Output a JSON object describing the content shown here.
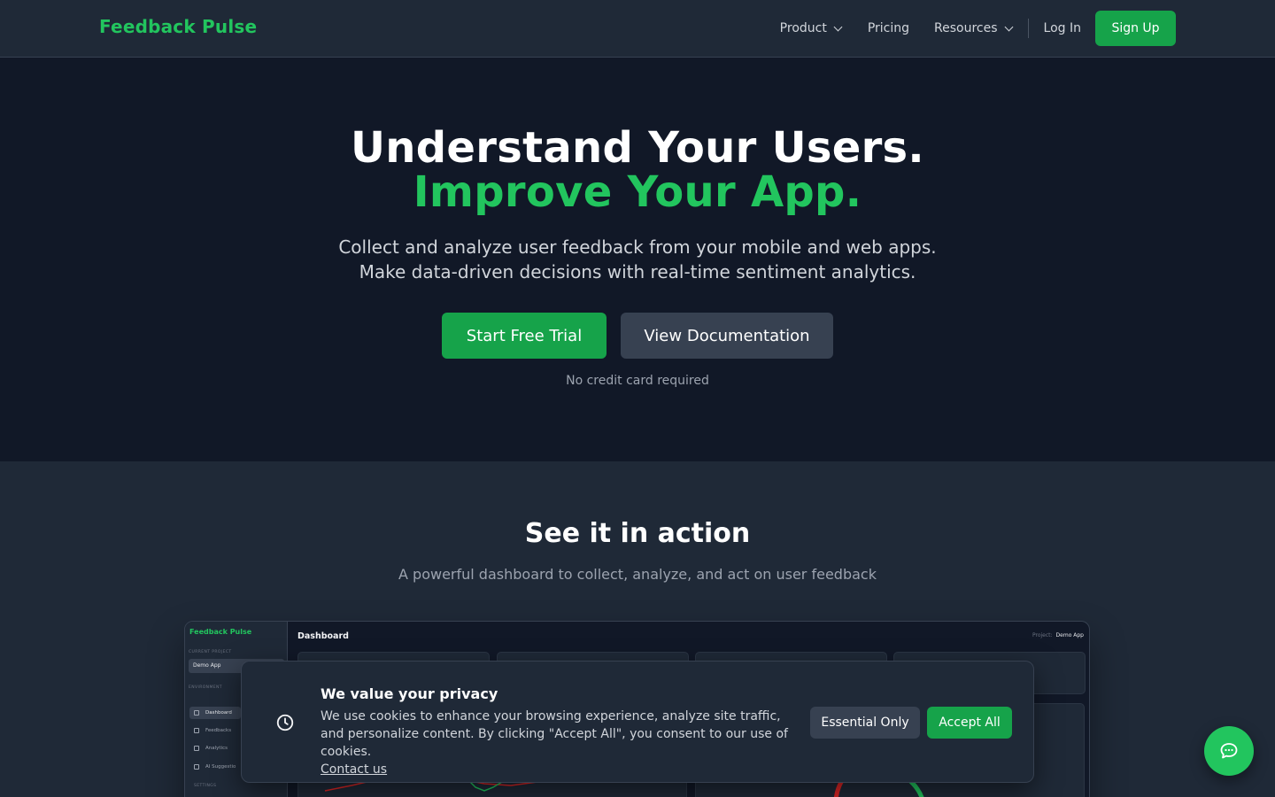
{
  "nav": {
    "brand": "Feedback Pulse",
    "product": "Product",
    "pricing": "Pricing",
    "resources": "Resources",
    "login": "Log In",
    "signup": "Sign Up"
  },
  "hero": {
    "title_line1": "Understand Your Users.",
    "title_line2": "Improve Your App.",
    "subtitle_line1": "Collect and analyze user feedback from your mobile and web apps.",
    "subtitle_line2": "Make data-driven decisions with real-time sentiment analytics.",
    "cta_primary": "Start Free Trial",
    "cta_secondary": "View Documentation",
    "note": "No credit card required"
  },
  "section": {
    "title": "See it in action",
    "subtitle": "A powerful dashboard to collect, analyze, and act on user feedback"
  },
  "preview": {
    "brand": "Feedback Pulse",
    "current_project_label": "CURRENT PROJECT",
    "project": "Demo App",
    "environment_label": "ENVIRONMENT",
    "menu": [
      "Dashboard",
      "Feedbacks",
      "Analytics",
      "AI Suggestio"
    ],
    "settings_label": "SETTINGS",
    "title": "Dashboard",
    "project_label": "Project:",
    "project_value": "Demo App"
  },
  "cookie": {
    "title": "We value your privacy",
    "text": "We use cookies to enhance your browsing experience, analyze site traffic, and personalize content. By clicking \"Accept All\", you consent to our use of cookies.",
    "link": "Contact us",
    "essential": "Essential Only",
    "accept": "Accept All"
  },
  "colors": {
    "accent": "#22c55e",
    "button_green": "#16a34a",
    "bg_dark": "#111827",
    "bg_panel": "#1f2937"
  },
  "icons": {
    "cookie": "clock-icon",
    "chat": "chat-bubble-icon"
  }
}
